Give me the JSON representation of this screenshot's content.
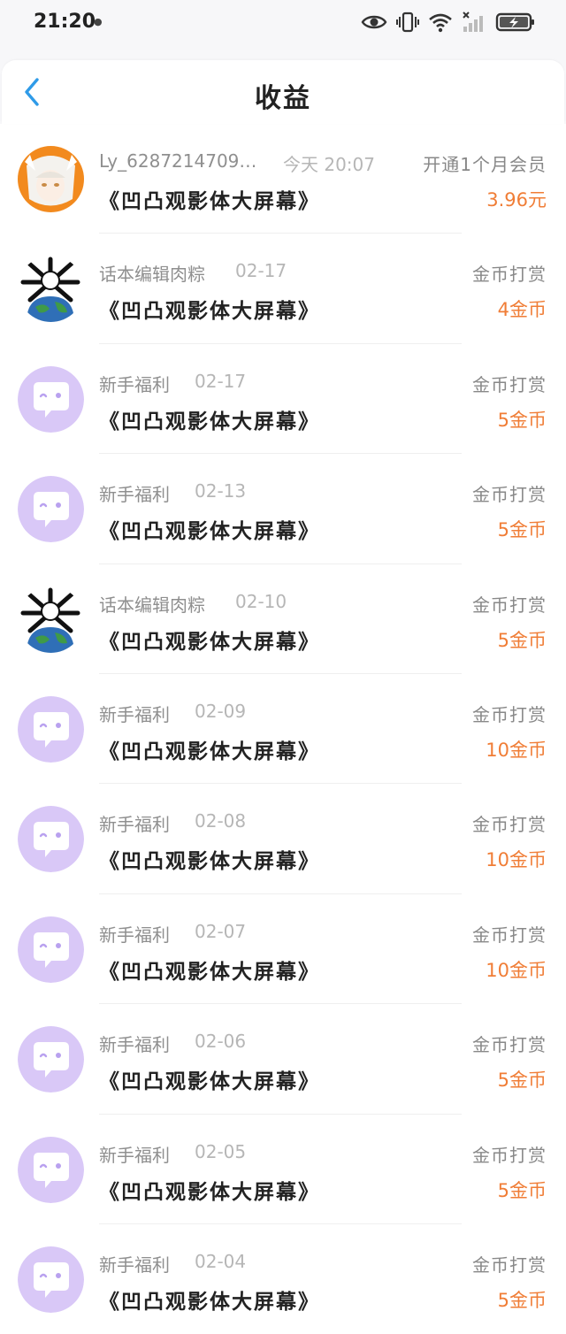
{
  "status_bar": {
    "time": "21:20"
  },
  "header": {
    "title": "收益"
  },
  "records": [
    {
      "avatar": "anime-avatar",
      "name": "Ly_6287214709…",
      "date": "今天 20:07",
      "type": "开通1个月会员",
      "work": "《凹凸观影体大屏幕》",
      "amount": "3.96元"
    },
    {
      "avatar": "earth-avatar",
      "name": "话本编辑肉粽",
      "date": "02-17",
      "type": "金币打赏",
      "work": "《凹凸观影体大屏幕》",
      "amount": "4金币"
    },
    {
      "avatar": "chat-avatar",
      "name": "新手福利",
      "date": "02-17",
      "type": "金币打赏",
      "work": "《凹凸观影体大屏幕》",
      "amount": "5金币"
    },
    {
      "avatar": "chat-avatar",
      "name": "新手福利",
      "date": "02-13",
      "type": "金币打赏",
      "work": "《凹凸观影体大屏幕》",
      "amount": "5金币"
    },
    {
      "avatar": "earth-avatar",
      "name": "话本编辑肉粽",
      "date": "02-10",
      "type": "金币打赏",
      "work": "《凹凸观影体大屏幕》",
      "amount": "5金币"
    },
    {
      "avatar": "chat-avatar",
      "name": "新手福利",
      "date": "02-09",
      "type": "金币打赏",
      "work": "《凹凸观影体大屏幕》",
      "amount": "10金币"
    },
    {
      "avatar": "chat-avatar",
      "name": "新手福利",
      "date": "02-08",
      "type": "金币打赏",
      "work": "《凹凸观影体大屏幕》",
      "amount": "10金币"
    },
    {
      "avatar": "chat-avatar",
      "name": "新手福利",
      "date": "02-07",
      "type": "金币打赏",
      "work": "《凹凸观影体大屏幕》",
      "amount": "10金币"
    },
    {
      "avatar": "chat-avatar",
      "name": "新手福利",
      "date": "02-06",
      "type": "金币打赏",
      "work": "《凹凸观影体大屏幕》",
      "amount": "5金币"
    },
    {
      "avatar": "chat-avatar",
      "name": "新手福利",
      "date": "02-05",
      "type": "金币打赏",
      "work": "《凹凸观影体大屏幕》",
      "amount": "5金币"
    },
    {
      "avatar": "chat-avatar",
      "name": "新手福利",
      "date": "02-04",
      "type": "金币打赏",
      "work": "《凹凸观影体大屏幕》",
      "amount": "5金币"
    }
  ],
  "colors": {
    "accent": "#2f9be8",
    "amount": "#f07d36",
    "avatar_purple": "#d9c8f7"
  }
}
